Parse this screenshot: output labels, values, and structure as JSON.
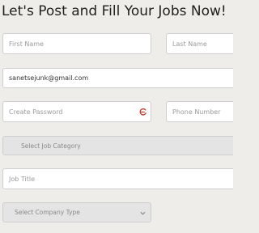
{
  "heading": "Let's Post and Fill Your Jobs Now!",
  "form": {
    "first_name": {
      "placeholder": "First Name"
    },
    "last_name": {
      "placeholder": "Last Name"
    },
    "email": {
      "value": "sanetsejunk@gmail.com"
    },
    "password": {
      "placeholder": "Create Password",
      "icon": "password-manager-icon"
    },
    "phone": {
      "placeholder": "Phone Number"
    },
    "job_category": {
      "selected": "Select Job Category"
    },
    "job_title": {
      "placeholder": "Job Title"
    },
    "company_type": {
      "selected": "Select Company Type"
    }
  },
  "colors": {
    "background": "#eeede9",
    "icon_accent": "#c0392b"
  }
}
